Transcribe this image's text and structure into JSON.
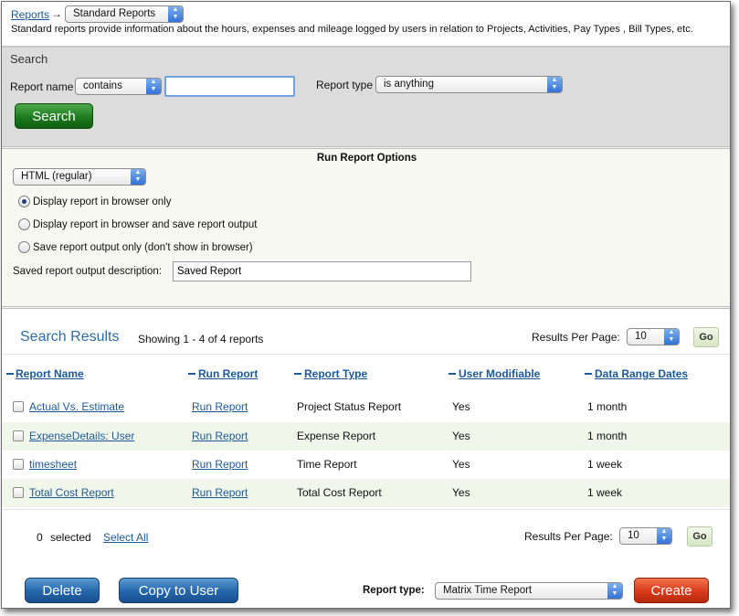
{
  "breadcrumb": {
    "root_link": "Reports",
    "arrow": "→",
    "current_select": "Standard Reports"
  },
  "description": "Standard reports provide information about the hours, expenses and mileage logged by users in relation to Projects, Activities, Pay Types , Bill Types, etc.",
  "search": {
    "title": "Search",
    "name_label": "Report name",
    "name_operator": "contains",
    "name_value": "",
    "type_label": "Report type",
    "type_value": "is anything",
    "button": "Search"
  },
  "run_options": {
    "title": "Run Report Options",
    "format": "HTML (regular)",
    "radios": [
      {
        "label": "Display report in browser only",
        "checked": true
      },
      {
        "label": "Display report in browser and save report output",
        "checked": false
      },
      {
        "label": "Save report output only (don't show in browser)",
        "checked": false
      }
    ],
    "desc_label": "Saved report output description:",
    "desc_value": "Saved Report"
  },
  "results": {
    "title": "Search Results",
    "showing": "Showing 1 - 4 of 4 reports",
    "per_page_label": "Results Per Page:",
    "per_page_value": "10",
    "go": "Go",
    "columns": [
      "Report Name",
      "Run Report",
      "Report Type",
      "User Modifiable",
      "Data Range Dates"
    ],
    "rows": [
      {
        "name": "Actual Vs. Estimate",
        "run": "Run Report",
        "type": "Project Status Report",
        "modifiable": "Yes",
        "range": "1 month"
      },
      {
        "name": "ExpenseDetails: User",
        "run": "Run Report",
        "type": "Expense Report",
        "modifiable": "Yes",
        "range": "1 month"
      },
      {
        "name": "timesheet",
        "run": "Run Report",
        "type": "Time Report",
        "modifiable": "Yes",
        "range": "1 week"
      },
      {
        "name": "Total Cost Report",
        "run": "Run Report",
        "type": "Total Cost Report",
        "modifiable": "Yes",
        "range": "1 week"
      }
    ]
  },
  "footer": {
    "selected_count": "0",
    "selected_label": "selected",
    "select_all": "Select All",
    "per_page_label": "Results Per Page:",
    "per_page_value": "10",
    "go": "Go"
  },
  "actions": {
    "delete": "Delete",
    "copy": "Copy to User",
    "report_type_label": "Report type:",
    "report_type_value": "Matrix Time Report",
    "create": "Create"
  },
  "colors": {
    "link": "#1b5a96",
    "search_button": "#1e7a1e",
    "create_button": "#d83a1a",
    "row_alt": "#f1f6ea"
  }
}
